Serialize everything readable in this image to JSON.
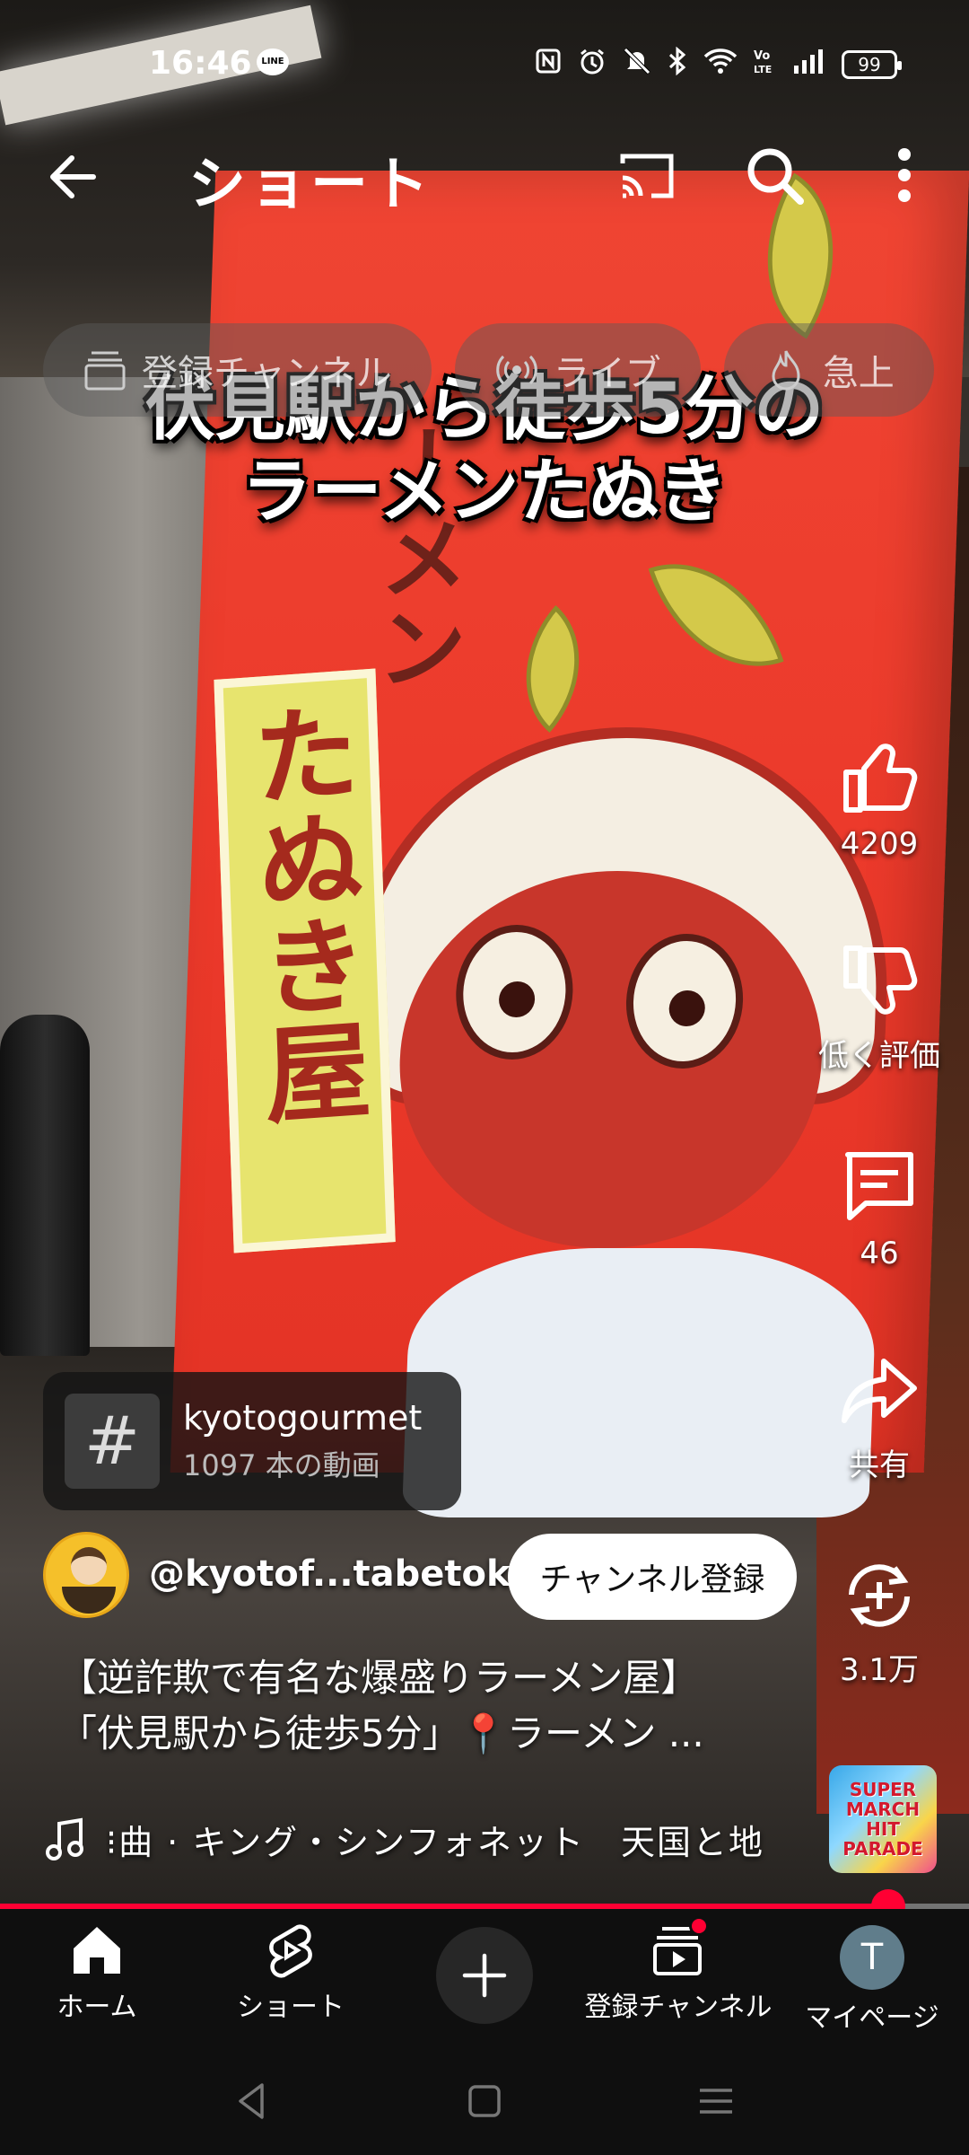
{
  "status_bar": {
    "time": "16:46",
    "line_badge": "LINE",
    "battery": "99"
  },
  "top_bar": {
    "title": "ショート"
  },
  "chips": [
    {
      "label": "登録チャンネル",
      "icon": "subscriptions-icon"
    },
    {
      "label": "ライブ",
      "icon": "live-icon"
    },
    {
      "label": "急上",
      "icon": "trending-icon"
    }
  ],
  "video": {
    "caption_line1": "伏見駅から徒歩5分の",
    "caption_line2": "ラーメンたぬき",
    "banner_vertical": "たぬき屋",
    "banner_vertical2": "ーメン"
  },
  "actions": {
    "like_count": "4209",
    "dislike_label": "低く評価",
    "comment_count": "46",
    "share_label": "共有",
    "remix_count": "3.1万"
  },
  "hashtag": {
    "name": "kyotogourmet",
    "count": "1097 本の動画"
  },
  "channel": {
    "handle": "@kyotof...tabetoku",
    "subscribe_label": "チャンネル登録"
  },
  "description": {
    "line1": "【逆詐欺で有名な爆盛りラーメン屋】",
    "line2": "「伏見駅から徒歩5分」📍ラーメン ..."
  },
  "music": {
    "text": "⁝曲 · キング・シンフォネット　天国と地",
    "thumb_text": "SUPER MARCH HIT PARADE"
  },
  "progress": {
    "fraction": 0.917
  },
  "bottom_nav": [
    {
      "label": "ホーム",
      "icon": "home-icon"
    },
    {
      "label": "ショート",
      "icon": "shorts-icon"
    },
    {
      "label": "",
      "icon": "create-icon"
    },
    {
      "label": "登録チャンネル",
      "icon": "subscriptions-icon"
    },
    {
      "label": "マイページ",
      "icon": "profile-avatar",
      "avatar_letter": "T"
    }
  ],
  "colors": {
    "accent": "#ff0033",
    "nav_bg": "#0f0f0f"
  }
}
